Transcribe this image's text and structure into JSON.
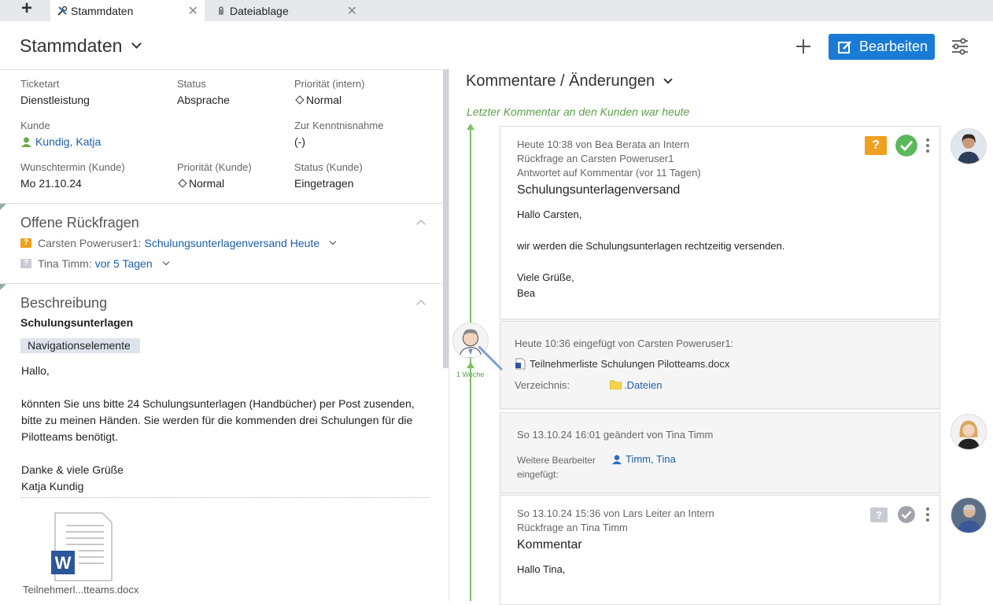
{
  "tabs": [
    {
      "label": "Stammdaten",
      "icon": "tools-icon"
    },
    {
      "label": "Dateiablage",
      "icon": "paperclip-icon"
    }
  ],
  "header": {
    "title": "Stammdaten",
    "edit_label": "Bearbeiten"
  },
  "fields": {
    "ticketart": {
      "label": "Ticketart",
      "value": "Dienstleistung"
    },
    "status": {
      "label": "Status",
      "value": "Absprache"
    },
    "prio_intern": {
      "label": "Priorität (intern)",
      "value": "Normal"
    },
    "kunde": {
      "label": "Kunde",
      "value": "Kundig, Katja"
    },
    "kenntnis": {
      "label": "Zur Kenntnisnahme",
      "value": "(-)"
    },
    "wunschtermin": {
      "label": "Wunschtermin (Kunde)",
      "value": "Mo 21.10.24"
    },
    "prio_kunde": {
      "label": "Priorität (Kunde)",
      "value": "Normal"
    },
    "status_kunde": {
      "label": "Status (Kunde)",
      "value": "Eingetragen"
    }
  },
  "rueckfragen": {
    "title": "Offene Rückfragen",
    "items": [
      {
        "name": "Carsten Poweruser1:",
        "link": "Schulungsunterlagenversand Heute",
        "icon_color": "#f0a020"
      },
      {
        "name": "Tina Timm:",
        "link": "vor 5 Tagen",
        "icon_color": "#c8ccd2"
      }
    ]
  },
  "beschreibung": {
    "title": "Beschreibung",
    "heading": "Schulungsunterlagen",
    "tag": "Navigationselemente",
    "body": [
      "Hallo,",
      "",
      "könnten Sie uns bitte 24 Schulungsunterlagen (Handbücher) per Post zusenden,",
      "bitte zu meinen Händen. Sie werden für die kommenden drei Schulungen für die",
      "Pilotteams benötigt.",
      "",
      "Danke & viele Grüße",
      "Katja Kundig"
    ],
    "attachment": "Teilnehmerl...tteams.docx"
  },
  "comments": {
    "title": "Kommentare / Änderungen",
    "last_comment": "Letzter Kommentar an den Kunden war heute",
    "timeline_label": "1 Woche",
    "card1": {
      "meta": [
        "Heute 10:38 von Bea Berata an Intern",
        "Rückfrage an Carsten Poweruser1",
        "Antwortet auf Kommentar (vor 11 Tagen)"
      ],
      "title": "Schulungsunterlagenversand",
      "body": [
        "Hallo Carsten,",
        "",
        "wir werden die Schulungsunterlagen rechtzeitig versenden.",
        "",
        "Viele Grüße,",
        "Bea"
      ]
    },
    "card2": {
      "meta": "Heute 10:36 eingefügt von Carsten Poweruser1:",
      "file": "Teilnehmerliste Schulungen Pilotteams.docx",
      "dir_label": "Verzeichnis:",
      "dir_value": ".Dateien"
    },
    "card3": {
      "meta": "So 13.10.24 16:01 geändert von Tina Timm",
      "label": "Weitere Bearbeiter eingefügt:",
      "value": "Timm, Tina"
    },
    "card4": {
      "meta": [
        "So 13.10.24 15:36 von Lars Leiter an Intern",
        "Rückfrage an Tina Timm"
      ],
      "title": "Kommentar",
      "body": [
        "Hallo Tina,"
      ]
    }
  },
  "colors": {
    "accent": "#1a7bd6",
    "link": "#1a5fa8",
    "timeline": "#7bc063",
    "question_active": "#f0a020",
    "check_active": "#5cb85c",
    "question_inactive": "#c8ccd2",
    "check_inactive": "#a0a4aa"
  }
}
